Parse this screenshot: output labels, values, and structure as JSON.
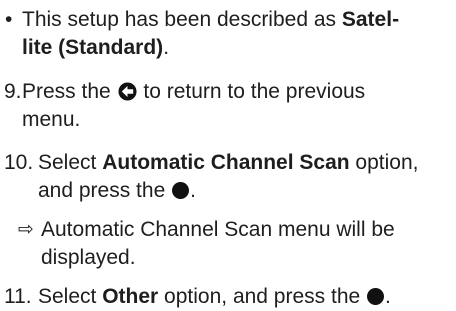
{
  "items": [
    {
      "marker": "•",
      "line1_pre": "This setup has been described as ",
      "line1_bold": "Satel-",
      "line2_bold": "lite (Standard)",
      "line2_post": "."
    },
    {
      "marker": "9.",
      "line1_pre": "Press the ",
      "icon": "back-arrow-icon",
      "line1_post": " to return to the previous",
      "line2": "menu."
    },
    {
      "marker": "10.",
      "line1_pre": "Select ",
      "line1_bold": "Automatic Channel Scan",
      "line1_post": " option,",
      "line2_pre": "and press the ",
      "icon": "ok-button-icon",
      "line2_post": "."
    },
    {
      "marker": "⇨",
      "line1": "Automatic Channel Scan menu will be",
      "line2": "displayed."
    },
    {
      "marker": "11.",
      "line1_pre": "Select ",
      "line1_bold": "Other",
      "line1_post": " option, and press the ",
      "icon": "ok-button-icon",
      "line1_end": "."
    }
  ]
}
